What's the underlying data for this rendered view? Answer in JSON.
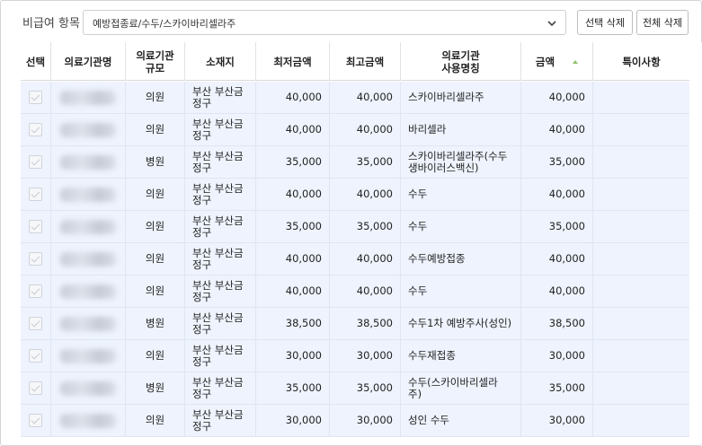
{
  "filter": {
    "label": "비급여 항목",
    "selected": "예방접종료/수두/스카이바리셀라주",
    "btn_select_delete": "선택 삭제",
    "btn_delete_all": "전체 삭제"
  },
  "table": {
    "columns": [
      "선택",
      "의료기관명",
      "의료기관\n규모",
      "소재지",
      "최저금액",
      "최고금액",
      "의료기관\n사용명칭",
      "금액",
      "특이사항"
    ],
    "rows": [
      {
        "size": "의원",
        "loc": "부산 부산금\n정구",
        "min": "40,000",
        "max": "40,000",
        "name": "스카이바리셀라주",
        "amt": "40,000",
        "note": ""
      },
      {
        "size": "의원",
        "loc": "부산 부산금\n정구",
        "min": "40,000",
        "max": "40,000",
        "name": "바리셀라",
        "amt": "40,000",
        "note": ""
      },
      {
        "size": "병원",
        "loc": "부산 부산금\n정구",
        "min": "35,000",
        "max": "35,000",
        "name": "스카이바리셀라주(수두\n생바이러스백신)",
        "amt": "35,000",
        "note": ""
      },
      {
        "size": "의원",
        "loc": "부산 부산금\n정구",
        "min": "40,000",
        "max": "40,000",
        "name": "수두",
        "amt": "40,000",
        "note": ""
      },
      {
        "size": "의원",
        "loc": "부산 부산금\n정구",
        "min": "35,000",
        "max": "35,000",
        "name": "수두",
        "amt": "35,000",
        "note": ""
      },
      {
        "size": "의원",
        "loc": "부산 부산금\n정구",
        "min": "40,000",
        "max": "40,000",
        "name": "수두예방접종",
        "amt": "40,000",
        "note": ""
      },
      {
        "size": "의원",
        "loc": "부산 부산금\n정구",
        "min": "40,000",
        "max": "40,000",
        "name": "수두",
        "amt": "40,000",
        "note": ""
      },
      {
        "size": "병원",
        "loc": "부산 부산금\n정구",
        "min": "38,500",
        "max": "38,500",
        "name": "수두1차 예방주사(성인)",
        "amt": "38,500",
        "note": ""
      },
      {
        "size": "의원",
        "loc": "부산 부산금\n정구",
        "min": "30,000",
        "max": "30,000",
        "name": "수두재접종",
        "amt": "30,000",
        "note": ""
      },
      {
        "size": "병원",
        "loc": "부산 부산금\n정구",
        "min": "35,000",
        "max": "35,000",
        "name": "수두(스카이바리셀라\n주)",
        "amt": "35,000",
        "note": ""
      },
      {
        "size": "의원",
        "loc": "부산 부산금\n정구",
        "min": "30,000",
        "max": "30,000",
        "name": "성인 수두",
        "amt": "30,000",
        "note": ""
      }
    ]
  }
}
